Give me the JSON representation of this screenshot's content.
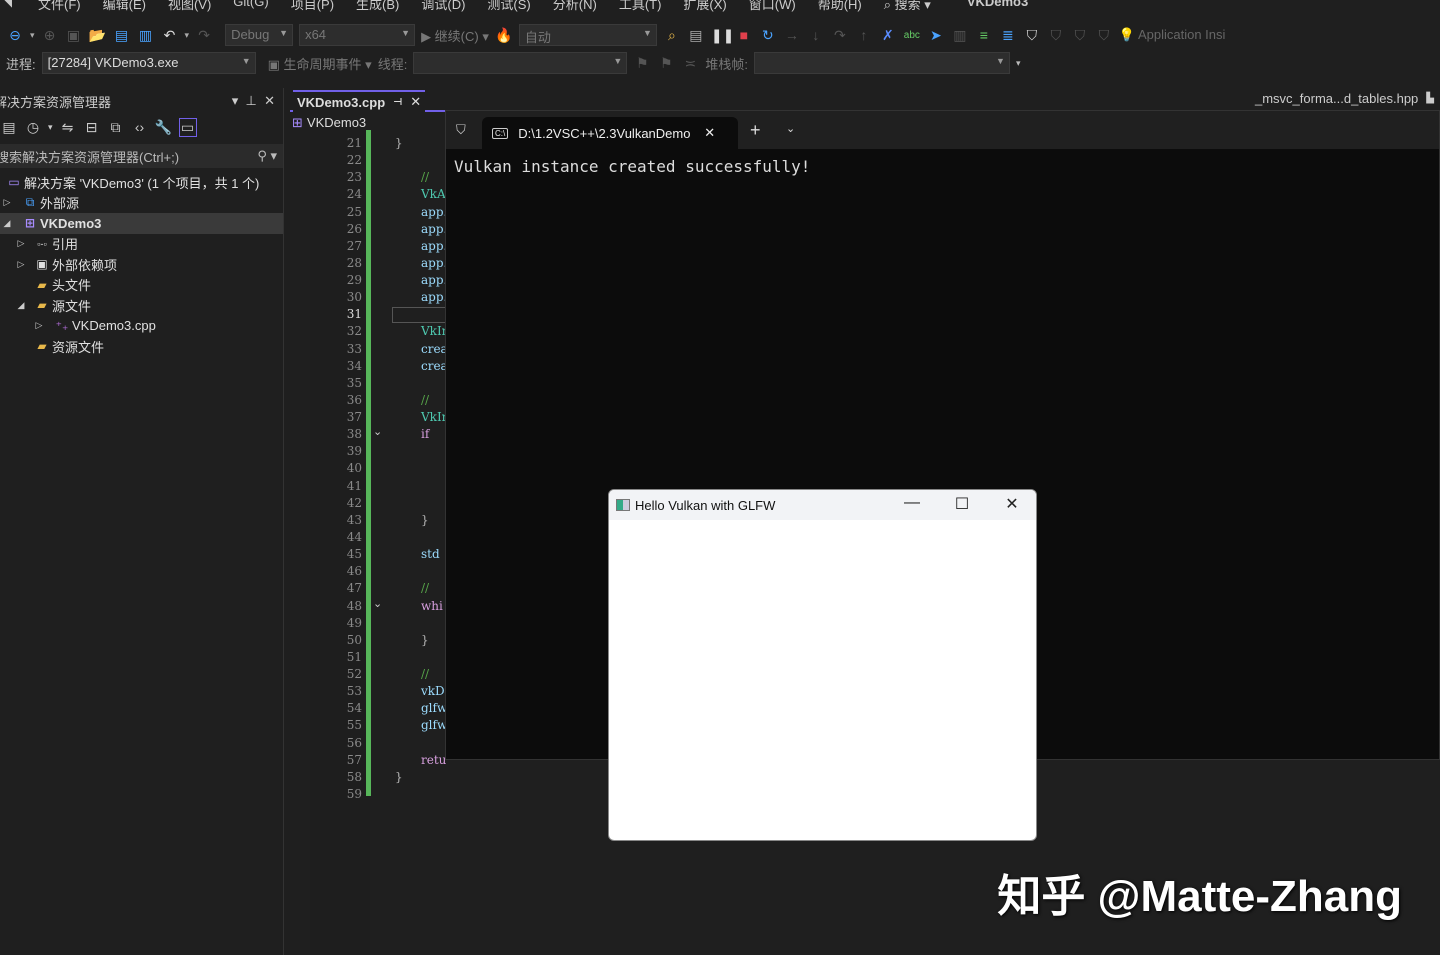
{
  "menu": {
    "items": [
      "文件(F)",
      "编辑(E)",
      "视图(V)",
      "Git(G)",
      "项目(P)",
      "生成(B)",
      "调试(D)",
      "测试(S)",
      "分析(N)",
      "工具(T)",
      "扩展(X)",
      "窗口(W)",
      "帮助(H)"
    ],
    "search": "搜索",
    "title": "VKDemo3"
  },
  "toolbar": {
    "config": "Debug",
    "platform": "x64",
    "continue": "继续(C)",
    "auto": "自动",
    "app_insights": "Application Insi"
  },
  "debugbar": {
    "process_label": "进程:",
    "process": "[27284] VKDemo3.exe",
    "lifecycle": "生命周期事件",
    "thread_label": "线程:",
    "stack_label": "堆栈帧:"
  },
  "sidebar": {
    "title": "解决方案资源管理器",
    "search_placeholder": "搜索解决方案资源管理器(Ctrl+;)",
    "items": [
      {
        "label": "解决方案 'VKDemo3' (1 个项目，共 1 个)",
        "icon": "solution-icon"
      },
      {
        "label": "外部源",
        "icon": "external-source-icon"
      },
      {
        "label": "VKDemo3",
        "icon": "project-icon"
      },
      {
        "label": "引用",
        "icon": "reference-icon"
      },
      {
        "label": "外部依赖项",
        "icon": "dependency-icon"
      },
      {
        "label": "头文件",
        "icon": "filter-folder-icon"
      },
      {
        "label": "源文件",
        "icon": "filter-folder-icon"
      },
      {
        "label": "VKDemo3.cpp",
        "icon": "cpp-file-icon"
      },
      {
        "label": "资源文件",
        "icon": "filter-folder-icon"
      }
    ]
  },
  "editor": {
    "active_tab": "VKDemo3.cpp",
    "right_tab": "_msvc_forma...d_tables.hpp",
    "nav_project": "VKDemo3",
    "lines": [
      {
        "n": "21",
        "t": "}"
      },
      {
        "n": "22",
        "t": ""
      },
      {
        "n": "23",
        "t": "// "
      },
      {
        "n": "24",
        "t": "VkAp"
      },
      {
        "n": "25",
        "t": "app."
      },
      {
        "n": "26",
        "t": "app."
      },
      {
        "n": "27",
        "t": "app."
      },
      {
        "n": "28",
        "t": "app."
      },
      {
        "n": "29",
        "t": "app."
      },
      {
        "n": "30",
        "t": "app."
      },
      {
        "n": "31",
        "t": ""
      },
      {
        "n": "32",
        "t": "VkIn"
      },
      {
        "n": "33",
        "t": "crea"
      },
      {
        "n": "34",
        "t": "crea"
      },
      {
        "n": "35",
        "t": ""
      },
      {
        "n": "36",
        "t": "// "
      },
      {
        "n": "37",
        "t": "VkIn"
      },
      {
        "n": "38",
        "t": "if"
      },
      {
        "n": "39",
        "t": ""
      },
      {
        "n": "40",
        "t": ""
      },
      {
        "n": "41",
        "t": ""
      },
      {
        "n": "42",
        "t": ""
      },
      {
        "n": "43",
        "t": "}"
      },
      {
        "n": "44",
        "t": ""
      },
      {
        "n": "45",
        "t": "std"
      },
      {
        "n": "46",
        "t": ""
      },
      {
        "n": "47",
        "t": "// "
      },
      {
        "n": "48",
        "t": "whi"
      },
      {
        "n": "49",
        "t": ""
      },
      {
        "n": "50",
        "t": "}"
      },
      {
        "n": "51",
        "t": ""
      },
      {
        "n": "52",
        "t": "// "
      },
      {
        "n": "53",
        "t": "vkDe"
      },
      {
        "n": "54",
        "t": "glfw"
      },
      {
        "n": "55",
        "t": "glfw"
      },
      {
        "n": "56",
        "t": ""
      },
      {
        "n": "57",
        "t": "retu"
      },
      {
        "n": "58",
        "t": "}"
      },
      {
        "n": "59",
        "t": ""
      }
    ]
  },
  "terminal": {
    "tab_title": "D:\\1.2VSC++\\2.3VulkanDemo",
    "output": "Vulkan instance created successfully!"
  },
  "glfw_window": {
    "title": "Hello Vulkan with GLFW"
  },
  "watermark": "知乎 @Matte-Zhang"
}
